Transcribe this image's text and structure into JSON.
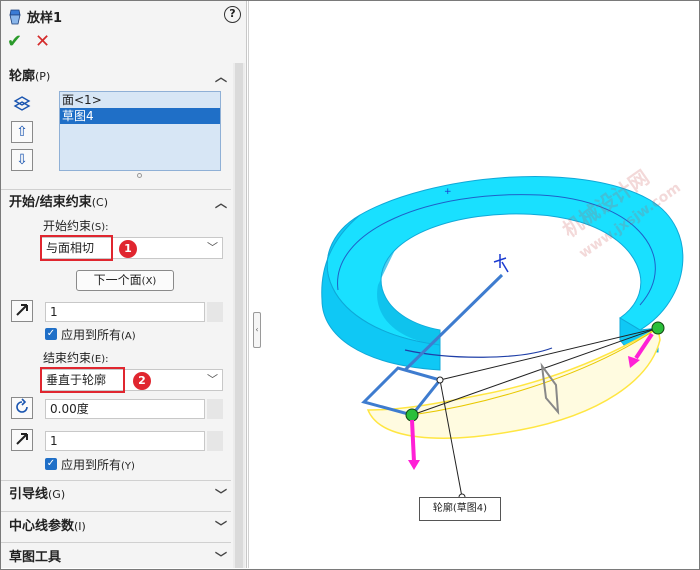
{
  "feature": {
    "title": "放样1",
    "ok_icon": "check-icon",
    "cancel_icon": "x-icon",
    "help_icon": "help-icon"
  },
  "profile_section": {
    "title": "轮廓",
    "shortcut": "(P)",
    "items": [
      "面<1>",
      "草图4"
    ],
    "selected_index": 1
  },
  "constraint_section": {
    "title": "开始/结束约束",
    "shortcut": "(C)",
    "start_label": "开始约束",
    "start_shortcut": "(S):",
    "start_value": "与面相切",
    "start_badge": "1",
    "next_face_label": "下一个面",
    "next_face_shortcut": "(X)",
    "start_tangent_length": "1",
    "apply_all_1": "应用到所有",
    "apply_all_1_shortcut": "(A)",
    "end_label": "结束约束",
    "end_shortcut": "(E):",
    "end_value": "垂直于轮廓",
    "end_badge": "2",
    "draft_angle": "0.00度",
    "end_tangent_length": "1",
    "apply_all_2": "应用到所有",
    "apply_all_2_shortcut": "(Y)"
  },
  "collapsed_sections": [
    {
      "title": "引导线",
      "shortcut": "(G)"
    },
    {
      "title": "中心线参数",
      "shortcut": "(I)"
    },
    {
      "title": "草图工具",
      "shortcut": ""
    }
  ],
  "viewport": {
    "callout_label": "轮廓(草图4)",
    "watermark_cn": "机械设计网",
    "watermark_en": "www.jxsjw.com"
  },
  "colors": {
    "accent": "#1f6fc7",
    "highlight": "#e0262f",
    "model": "#19e0ff",
    "direction_arrow": "#ff20d6",
    "ok": "#2a9a2a"
  }
}
